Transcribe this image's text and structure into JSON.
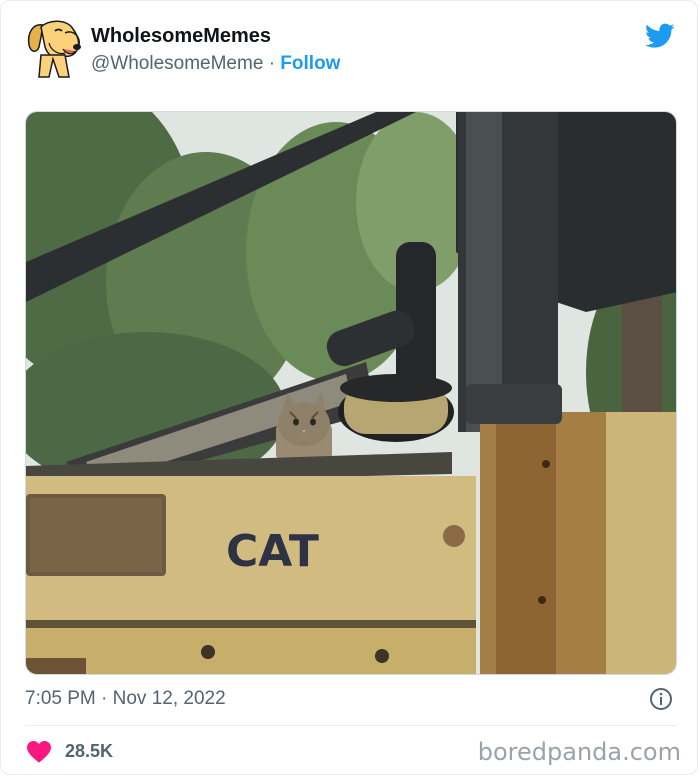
{
  "tweet": {
    "display_name": "WholesomeMemes",
    "handle": "@WholesomeMeme",
    "separator": "·",
    "follow_label": "Follow",
    "timestamp": "7:05 PM · Nov 12, 2022",
    "likes": "28.5K"
  },
  "media": {
    "vehicle_label": "CAT"
  },
  "watermark": "boredpanda.com",
  "icons": {
    "avatar": "dog-avatar-icon",
    "brand": "twitter-bird-icon",
    "info": "info-icon",
    "like": "heart-icon"
  },
  "colors": {
    "twitter_blue": "#1d9bf0",
    "like_pink": "#f91880",
    "text_secondary": "#536471"
  }
}
